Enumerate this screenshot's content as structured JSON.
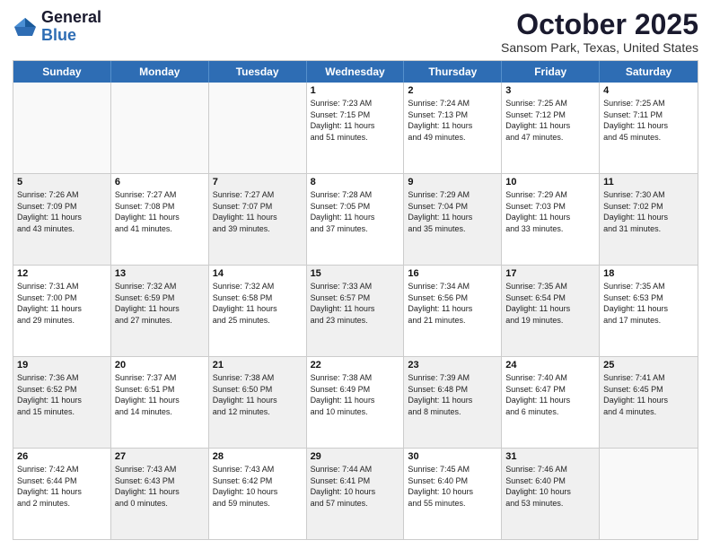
{
  "header": {
    "logo_general": "General",
    "logo_blue": "Blue",
    "month_title": "October 2025",
    "location": "Sansom Park, Texas, United States"
  },
  "calendar": {
    "days_of_week": [
      "Sunday",
      "Monday",
      "Tuesday",
      "Wednesday",
      "Thursday",
      "Friday",
      "Saturday"
    ],
    "rows": [
      [
        {
          "day": "",
          "info": "",
          "empty": true
        },
        {
          "day": "",
          "info": "",
          "empty": true
        },
        {
          "day": "",
          "info": "",
          "empty": true
        },
        {
          "day": "1",
          "info": "Sunrise: 7:23 AM\nSunset: 7:15 PM\nDaylight: 11 hours\nand 51 minutes."
        },
        {
          "day": "2",
          "info": "Sunrise: 7:24 AM\nSunset: 7:13 PM\nDaylight: 11 hours\nand 49 minutes."
        },
        {
          "day": "3",
          "info": "Sunrise: 7:25 AM\nSunset: 7:12 PM\nDaylight: 11 hours\nand 47 minutes."
        },
        {
          "day": "4",
          "info": "Sunrise: 7:25 AM\nSunset: 7:11 PM\nDaylight: 11 hours\nand 45 minutes."
        }
      ],
      [
        {
          "day": "5",
          "info": "Sunrise: 7:26 AM\nSunset: 7:09 PM\nDaylight: 11 hours\nand 43 minutes.",
          "shaded": true
        },
        {
          "day": "6",
          "info": "Sunrise: 7:27 AM\nSunset: 7:08 PM\nDaylight: 11 hours\nand 41 minutes."
        },
        {
          "day": "7",
          "info": "Sunrise: 7:27 AM\nSunset: 7:07 PM\nDaylight: 11 hours\nand 39 minutes.",
          "shaded": true
        },
        {
          "day": "8",
          "info": "Sunrise: 7:28 AM\nSunset: 7:05 PM\nDaylight: 11 hours\nand 37 minutes."
        },
        {
          "day": "9",
          "info": "Sunrise: 7:29 AM\nSunset: 7:04 PM\nDaylight: 11 hours\nand 35 minutes.",
          "shaded": true
        },
        {
          "day": "10",
          "info": "Sunrise: 7:29 AM\nSunset: 7:03 PM\nDaylight: 11 hours\nand 33 minutes."
        },
        {
          "day": "11",
          "info": "Sunrise: 7:30 AM\nSunset: 7:02 PM\nDaylight: 11 hours\nand 31 minutes.",
          "shaded": true
        }
      ],
      [
        {
          "day": "12",
          "info": "Sunrise: 7:31 AM\nSunset: 7:00 PM\nDaylight: 11 hours\nand 29 minutes."
        },
        {
          "day": "13",
          "info": "Sunrise: 7:32 AM\nSunset: 6:59 PM\nDaylight: 11 hours\nand 27 minutes.",
          "shaded": true
        },
        {
          "day": "14",
          "info": "Sunrise: 7:32 AM\nSunset: 6:58 PM\nDaylight: 11 hours\nand 25 minutes."
        },
        {
          "day": "15",
          "info": "Sunrise: 7:33 AM\nSunset: 6:57 PM\nDaylight: 11 hours\nand 23 minutes.",
          "shaded": true
        },
        {
          "day": "16",
          "info": "Sunrise: 7:34 AM\nSunset: 6:56 PM\nDaylight: 11 hours\nand 21 minutes."
        },
        {
          "day": "17",
          "info": "Sunrise: 7:35 AM\nSunset: 6:54 PM\nDaylight: 11 hours\nand 19 minutes.",
          "shaded": true
        },
        {
          "day": "18",
          "info": "Sunrise: 7:35 AM\nSunset: 6:53 PM\nDaylight: 11 hours\nand 17 minutes."
        }
      ],
      [
        {
          "day": "19",
          "info": "Sunrise: 7:36 AM\nSunset: 6:52 PM\nDaylight: 11 hours\nand 15 minutes.",
          "shaded": true
        },
        {
          "day": "20",
          "info": "Sunrise: 7:37 AM\nSunset: 6:51 PM\nDaylight: 11 hours\nand 14 minutes."
        },
        {
          "day": "21",
          "info": "Sunrise: 7:38 AM\nSunset: 6:50 PM\nDaylight: 11 hours\nand 12 minutes.",
          "shaded": true
        },
        {
          "day": "22",
          "info": "Sunrise: 7:38 AM\nSunset: 6:49 PM\nDaylight: 11 hours\nand 10 minutes."
        },
        {
          "day": "23",
          "info": "Sunrise: 7:39 AM\nSunset: 6:48 PM\nDaylight: 11 hours\nand 8 minutes.",
          "shaded": true
        },
        {
          "day": "24",
          "info": "Sunrise: 7:40 AM\nSunset: 6:47 PM\nDaylight: 11 hours\nand 6 minutes."
        },
        {
          "day": "25",
          "info": "Sunrise: 7:41 AM\nSunset: 6:45 PM\nDaylight: 11 hours\nand 4 minutes.",
          "shaded": true
        }
      ],
      [
        {
          "day": "26",
          "info": "Sunrise: 7:42 AM\nSunset: 6:44 PM\nDaylight: 11 hours\nand 2 minutes."
        },
        {
          "day": "27",
          "info": "Sunrise: 7:43 AM\nSunset: 6:43 PM\nDaylight: 11 hours\nand 0 minutes.",
          "shaded": true
        },
        {
          "day": "28",
          "info": "Sunrise: 7:43 AM\nSunset: 6:42 PM\nDaylight: 10 hours\nand 59 minutes."
        },
        {
          "day": "29",
          "info": "Sunrise: 7:44 AM\nSunset: 6:41 PM\nDaylight: 10 hours\nand 57 minutes.",
          "shaded": true
        },
        {
          "day": "30",
          "info": "Sunrise: 7:45 AM\nSunset: 6:40 PM\nDaylight: 10 hours\nand 55 minutes."
        },
        {
          "day": "31",
          "info": "Sunrise: 7:46 AM\nSunset: 6:40 PM\nDaylight: 10 hours\nand 53 minutes.",
          "shaded": true
        },
        {
          "day": "",
          "info": "",
          "empty": true
        }
      ]
    ]
  }
}
